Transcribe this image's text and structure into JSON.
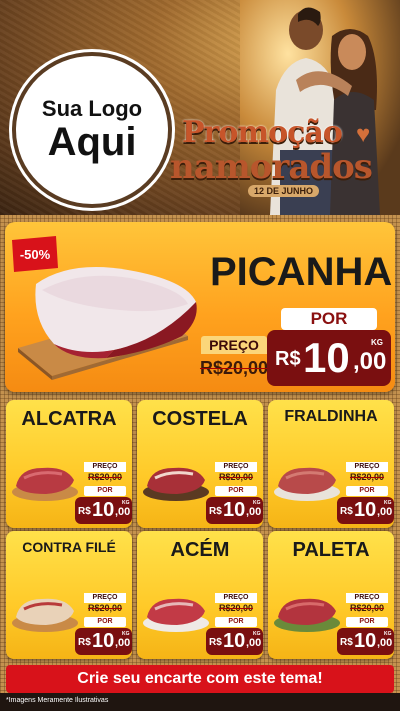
{
  "logo": {
    "line1": "Sua Logo",
    "line2": "Aqui"
  },
  "campaign": {
    "line1": "Promoção",
    "line2": "namorados",
    "date": "12 DE JUNHO"
  },
  "featured": {
    "name": "PICANHA",
    "discount": "-50%",
    "preco_label": "PREÇO",
    "old_price": "R$20,00",
    "por_label": "POR",
    "currency": "R$",
    "price_int": "10",
    "price_dec": ",00",
    "unit": "KG"
  },
  "products": [
    {
      "name": "ALCATRA",
      "preco_label": "PREÇO",
      "old_price": "R$20,00",
      "por_label": "POR",
      "currency": "R$",
      "price_int": "10",
      "price_dec": ",00",
      "unit": "KG"
    },
    {
      "name": "COSTELA",
      "preco_label": "PREÇO",
      "old_price": "R$20,00",
      "por_label": "POR",
      "currency": "R$",
      "price_int": "10",
      "price_dec": ",00",
      "unit": "KG"
    },
    {
      "name": "FRALDINHA",
      "preco_label": "PREÇO",
      "old_price": "R$20,00",
      "por_label": "POR",
      "currency": "R$",
      "price_int": "10",
      "price_dec": ",00",
      "unit": "KG"
    },
    {
      "name": "CONTRA FILÉ",
      "preco_label": "PREÇO",
      "old_price": "R$20,00",
      "por_label": "POR",
      "currency": "R$",
      "price_int": "10",
      "price_dec": ",00",
      "unit": "KG"
    },
    {
      "name": "ACÉM",
      "preco_label": "PREÇO",
      "old_price": "R$20,00",
      "por_label": "POR",
      "currency": "R$",
      "price_int": "10",
      "price_dec": ",00",
      "unit": "KG"
    },
    {
      "name": "PALETA",
      "preco_label": "PREÇO",
      "old_price": "R$20,00",
      "por_label": "POR",
      "currency": "R$",
      "price_int": "10",
      "price_dec": ",00",
      "unit": "KG"
    }
  ],
  "cta": {
    "label": "Crie seu encarte com este tema!"
  },
  "footer": {
    "disclaimer": "*Imagens Meramente Ilustrativas"
  },
  "colors": {
    "price_box": "#7a0f10",
    "discount": "#d8121a",
    "cta": "#d8121a",
    "card": "#ffd22e",
    "featured": "#ffa21e"
  }
}
